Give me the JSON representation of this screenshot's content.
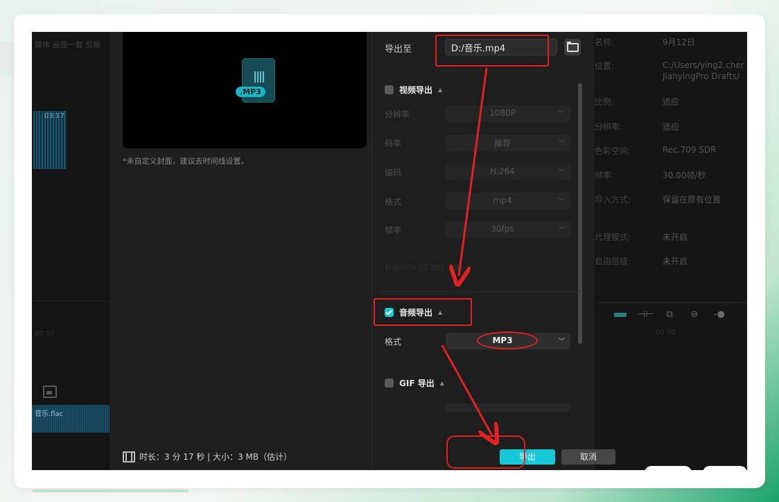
{
  "background_editor": {
    "left_blur_text": "媒体  画面一套  剪辑",
    "clip_label": "03:17",
    "left_timestamp": "00:00",
    "audio_clip_label": "音乐.flac",
    "right_timestamp": "00:00",
    "properties": [
      {
        "key": "名称:",
        "value": "9月12日"
      },
      {
        "key": "位置:",
        "value": "C:/Users/ying2.cher JianyingPro Drafts/"
      },
      {
        "key": "比例:",
        "value": "适应"
      },
      {
        "key": "分辨率:",
        "value": "适应"
      },
      {
        "key": "色彩空间:",
        "value": "Rec.709 SDR"
      },
      {
        "key": "帧率:",
        "value": "30.00帧/秒"
      },
      {
        "key": "导入方式:",
        "value": "保留在原有位置"
      },
      {
        "key": "代理模式:",
        "value": "未开启"
      },
      {
        "key": "自由层级:",
        "value": "未开启"
      }
    ]
  },
  "dialog": {
    "preview": {
      "badge": ".MP3",
      "cover_note": "*未自定义封面，建议去时间线设置。"
    },
    "export_to_label": "导出至",
    "export_path": "D:/音乐.mp4",
    "video_section": {
      "title": "视频导出",
      "checked": false,
      "settings": [
        {
          "label": "分辨率",
          "value": "1080P"
        },
        {
          "label": "码率",
          "value": "推荐"
        },
        {
          "label": "编码",
          "value": "H.264"
        },
        {
          "label": "格式",
          "value": "mp4"
        },
        {
          "label": "帧率",
          "value": "30fps"
        }
      ],
      "faded_option": "智能HDR  (实验性功能)"
    },
    "audio_section": {
      "title": "音频导出",
      "checked": true,
      "format_label": "格式",
      "format_value": "MP3"
    },
    "gif_section": {
      "title": "GIF 导出",
      "checked": false
    },
    "footer_info": "时长：3 分 17 秒 | 大小：3 MB（估计）",
    "export_button": "导出",
    "cancel_button": "取消"
  },
  "annotation_color": "#e02222",
  "accent_color": "#16c7d6"
}
